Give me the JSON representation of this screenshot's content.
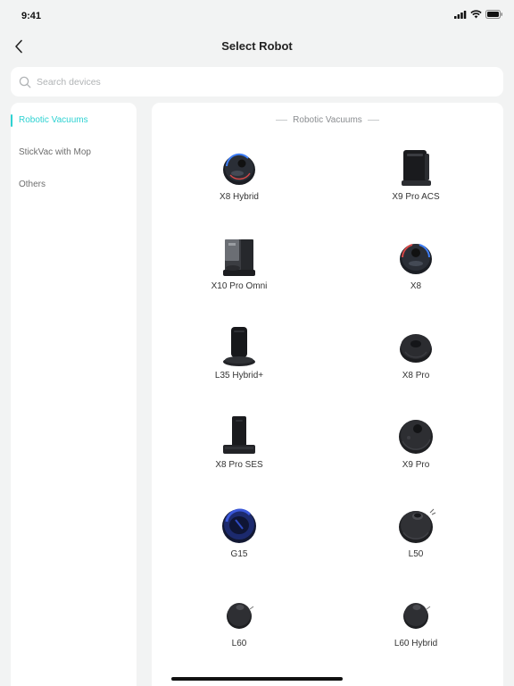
{
  "status_bar": {
    "time": "9:41"
  },
  "header": {
    "title": "Select Robot"
  },
  "search": {
    "placeholder": "Search devices"
  },
  "sidebar": {
    "items": [
      {
        "label": "Robotic Vacuums",
        "active": true
      },
      {
        "label": "StickVac with Mop",
        "active": false
      },
      {
        "label": "Others",
        "active": false
      }
    ]
  },
  "content": {
    "section_title": "Robotic Vacuums",
    "devices": [
      {
        "name": "X8 Hybrid",
        "icon": "round-robot-vacuum-blue-icon"
      },
      {
        "name": "X9 Pro ACS",
        "icon": "cleaning-station-icon"
      },
      {
        "name": "X10 Pro Omni",
        "icon": "omni-station-icon"
      },
      {
        "name": "X8",
        "icon": "round-robot-vacuum-red-icon"
      },
      {
        "name": "L35 Hybrid+",
        "icon": "tower-station-icon"
      },
      {
        "name": "X8 Pro",
        "icon": "round-robot-vacuum-icon"
      },
      {
        "name": "X8 Pro SES",
        "icon": "dock-station-icon"
      },
      {
        "name": "X9 Pro",
        "icon": "round-robot-vacuum-icon"
      },
      {
        "name": "G15",
        "icon": "round-robot-vacuum-blue-icon"
      },
      {
        "name": "L50",
        "icon": "lidar-robot-vacuum-icon"
      },
      {
        "name": "L60",
        "icon": "small-robot-vacuum-icon"
      },
      {
        "name": "L60 Hybrid",
        "icon": "small-robot-vacuum-icon"
      }
    ]
  },
  "colors": {
    "accent": "#2ed2d2",
    "background": "#f2f3f3",
    "panel": "#ffffff",
    "text": "#333333",
    "muted": "#8a8d90"
  }
}
